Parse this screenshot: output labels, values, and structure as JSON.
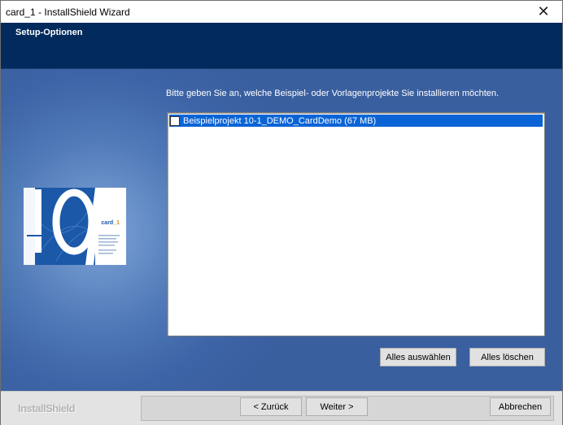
{
  "window": {
    "title": "card_1 - InstallShield Wizard",
    "close_glyph": "✕"
  },
  "header": {
    "title": "Setup-Optionen"
  },
  "logo": {
    "number": "10",
    "brand_prefix": "card",
    "brand_suffix": "_1"
  },
  "main": {
    "instruction": "Bitte geben Sie an, welche Beispiel- oder Vorlagenprojekte Sie installieren möchten.",
    "list_items": [
      {
        "label": "Beispielprojekt 10-1_DEMO_CardDemo (67 MB)",
        "checked": false,
        "selected": true
      }
    ],
    "select_all_label": "Alles auswählen",
    "clear_all_label": "Alles löschen"
  },
  "footer": {
    "brand": "InstallShield",
    "back_label": "< Zurück",
    "next_label": "Weiter >",
    "cancel_label": "Abbrechen"
  },
  "colors": {
    "header_bg": "#022a5c",
    "content_bg": "#3d64a6",
    "selection": "#0a64d6"
  }
}
